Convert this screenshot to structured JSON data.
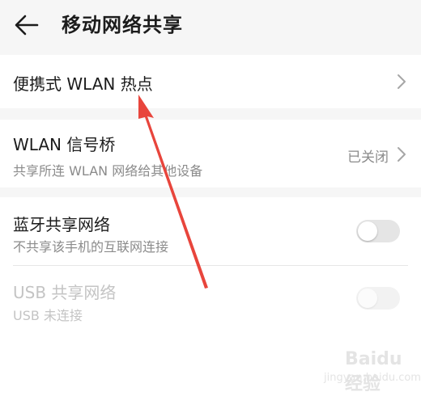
{
  "header": {
    "title": "移动网络共享"
  },
  "items": [
    {
      "title": "便携式 WLAN 热点"
    },
    {
      "title": "WLAN 信号桥",
      "subtitle": "共享所连 WLAN 网络给其他设备",
      "value": "已关闭"
    },
    {
      "title": "蓝牙共享网络",
      "subtitle": "不共享该手机的互联网连接",
      "toggle_on": false
    },
    {
      "title": "USB 共享网络",
      "subtitle": "USB 未连接",
      "toggle_on": false,
      "enabled": false
    }
  ],
  "watermark": {
    "main": "Baidu 经验",
    "sub": "jingyan.baidu.com"
  },
  "colors": {
    "annotation_arrow": "#e8453c"
  }
}
